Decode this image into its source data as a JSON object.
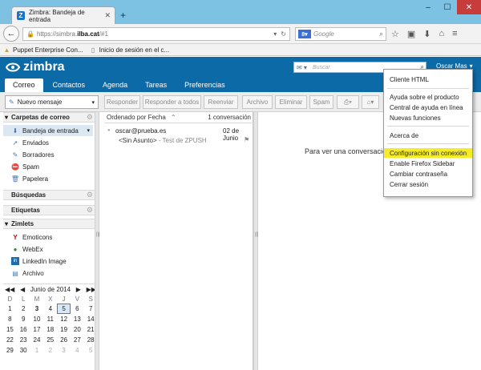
{
  "browser": {
    "tab_title": "Zimbra: Bandeja de entrada",
    "tab_favicon": "Z",
    "url_scheme": "https://simbra.",
    "url_domain": "ilba.cat",
    "url_path": "/#1",
    "search_engine": "Google",
    "bookmarks": [
      {
        "label": "Puppet Enterprise Con...",
        "icon": "puppet-icon"
      },
      {
        "label": "Inicio de sesión en el c...",
        "icon": "page-icon"
      }
    ]
  },
  "zimbra": {
    "logo_text": "zimbra",
    "search_placeholder": "Buscar",
    "user_name": "Oscar Mas",
    "app_tabs": [
      "Correo",
      "Contactos",
      "Agenda",
      "Tareas",
      "Preferencias"
    ],
    "toolbar": {
      "new_message": "Nuevo mensaje",
      "buttons": [
        "Responder",
        "Responder a todos",
        "Reenviar",
        "Archivo",
        "Eliminar",
        "Spam"
      ]
    },
    "sidebar": {
      "mail_folders_title": "Carpetas de correo",
      "folders": [
        "Bandeja de entrada",
        "Enviados",
        "Borradores",
        "Spam",
        "Papelera"
      ],
      "searches_title": "Búsquedas",
      "tags_title": "Etiquetas",
      "zimlets_title": "Zimlets",
      "zimlets": [
        "Emoticons",
        "WebEx",
        "LinkedIn Image",
        "Archivo"
      ]
    },
    "calendar": {
      "month": "Junio de 2014",
      "weekdays": [
        "D",
        "L",
        "M",
        "X",
        "J",
        "V",
        "S"
      ],
      "weeks": [
        [
          "1",
          "2",
          "3",
          "4",
          "5",
          "6",
          "7"
        ],
        [
          "8",
          "9",
          "10",
          "11",
          "12",
          "13",
          "14"
        ],
        [
          "15",
          "16",
          "17",
          "18",
          "19",
          "20",
          "21"
        ],
        [
          "22",
          "23",
          "24",
          "25",
          "26",
          "27",
          "28"
        ],
        [
          "29",
          "30",
          "1",
          "2",
          "3",
          "4",
          "5"
        ]
      ]
    },
    "message_list": {
      "sort_label": "Ordenado por Fecha",
      "count_label": "1 conversación",
      "messages": [
        {
          "from": "oscar@prueba.es",
          "date": "02 de Junio",
          "subject": "<Sin Asunto>",
          "fragment": " - Test de ZPUSH"
        }
      ]
    },
    "reading_pane_text": "Para ver una conversación",
    "user_menu": [
      "Cliente HTML",
      "Ayuda sobre el producto",
      "Central de ayuda en línea",
      "Nuevas funciones",
      "Acerca de",
      "Configuración sin conexión",
      "Enable Firefox Sidebar",
      "Cambiar contraseña",
      "Cerrar sesión"
    ],
    "highlight_color": "#f5ec27",
    "brand_color": "#0c6aa6"
  }
}
